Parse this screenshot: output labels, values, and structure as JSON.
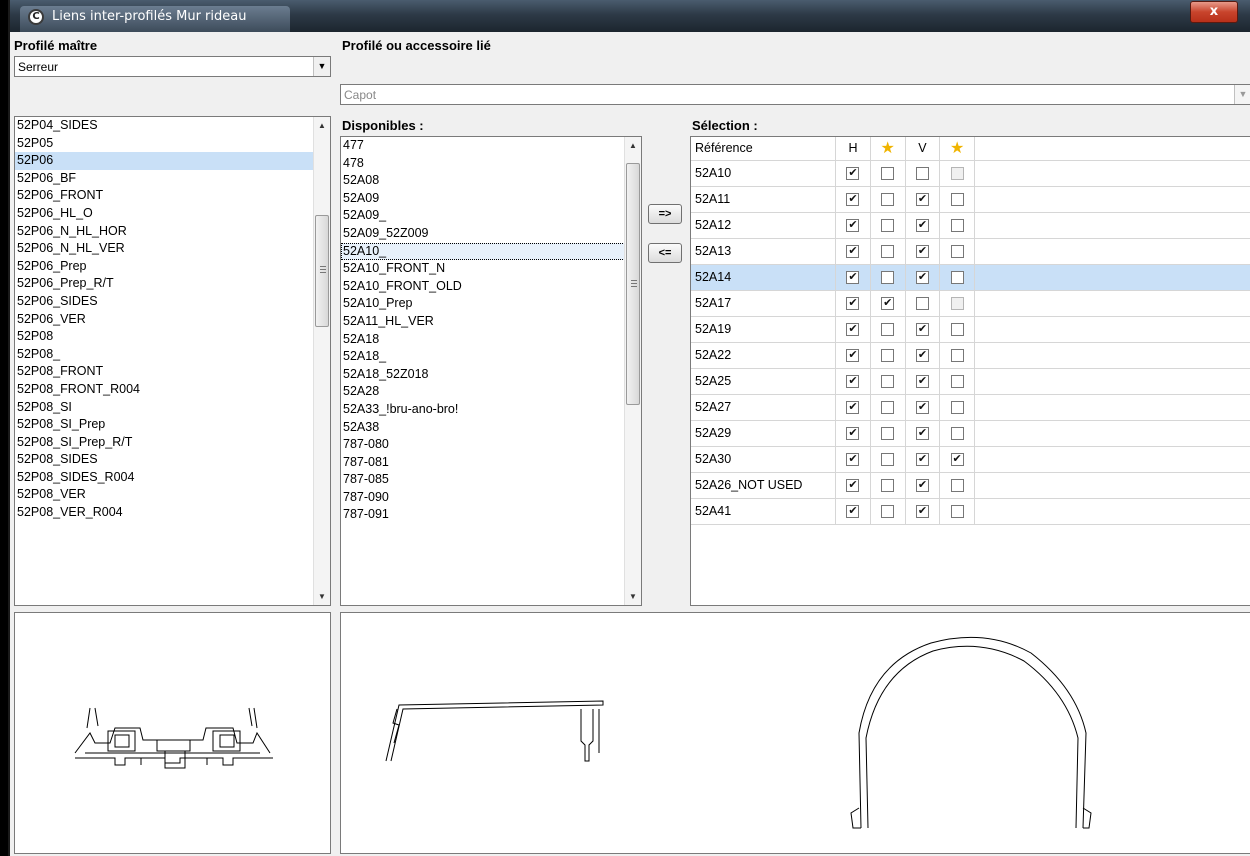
{
  "window": {
    "title": "Liens inter-profilés Mur rideau",
    "close_label": "x",
    "app_icon_glyph": "C"
  },
  "master": {
    "label": "Profilé maître",
    "combo_value": "Serreur",
    "items": [
      "52P04_SIDES",
      "52P05",
      "52P06",
      "52P06_BF",
      "52P06_FRONT",
      "52P06_HL_O",
      "52P06_N_HL_HOR",
      "52P06_N_HL_VER",
      "52P06_Prep",
      "52P06_Prep_R/T",
      "52P06_SIDES",
      "52P06_VER",
      "52P08",
      "52P08_",
      "52P08_FRONT",
      "52P08_FRONT_R004",
      "52P08_SI",
      "52P08_SI_Prep",
      "52P08_SI_Prep_R/T",
      "52P08_SIDES",
      "52P08_SIDES_R004",
      "52P08_VER",
      "52P08_VER_R004"
    ],
    "selected_index": 2
  },
  "linked": {
    "label": "Profilé ou accessoire lié",
    "combo_value": "Capot"
  },
  "available": {
    "label": "Disponibles :",
    "items": [
      "477",
      "478",
      "52A08",
      "52A09",
      "52A09_",
      "52A09_52Z009",
      "52A10_",
      "52A10_FRONT_N",
      "52A10_FRONT_OLD",
      "52A10_Prep",
      "52A11_HL_VER",
      "52A18",
      "52A18_",
      "52A18_52Z018",
      "52A28",
      "52A33_!bru-ano-bro!",
      "52A38",
      "787-080",
      "787-081",
      "787-085",
      "787-090",
      "787-091"
    ],
    "focused_index": 6
  },
  "buttons": {
    "add": "=>",
    "remove": "<="
  },
  "selection": {
    "label": "Sélection :",
    "headers": {
      "ref": "Référence",
      "h": "H",
      "v": "V"
    },
    "star_icon": "star-icon",
    "selected_row": 4,
    "rows": [
      {
        "ref": "52A10",
        "h": true,
        "hs": false,
        "v": false,
        "vs": false,
        "vs_grey": true
      },
      {
        "ref": "52A11",
        "h": true,
        "hs": false,
        "v": true,
        "vs": false,
        "vs_grey": false
      },
      {
        "ref": "52A12",
        "h": true,
        "hs": false,
        "v": true,
        "vs": false,
        "vs_grey": false
      },
      {
        "ref": "52A13",
        "h": true,
        "hs": false,
        "v": true,
        "vs": false,
        "vs_grey": false
      },
      {
        "ref": "52A14",
        "h": true,
        "hs": false,
        "v": true,
        "vs": false,
        "vs_grey": false
      },
      {
        "ref": "52A17",
        "h": true,
        "hs": true,
        "v": false,
        "vs": false,
        "vs_grey": true
      },
      {
        "ref": "52A19",
        "h": true,
        "hs": false,
        "v": true,
        "vs": false,
        "vs_grey": false
      },
      {
        "ref": "52A22",
        "h": true,
        "hs": false,
        "v": true,
        "vs": false,
        "vs_grey": false
      },
      {
        "ref": "52A25",
        "h": true,
        "hs": false,
        "v": true,
        "vs": false,
        "vs_grey": false
      },
      {
        "ref": "52A27",
        "h": true,
        "hs": false,
        "v": true,
        "vs": false,
        "vs_grey": false
      },
      {
        "ref": "52A29",
        "h": true,
        "hs": false,
        "v": true,
        "vs": false,
        "vs_grey": false
      },
      {
        "ref": "52A30",
        "h": true,
        "hs": false,
        "v": true,
        "vs": true,
        "vs_grey": false
      },
      {
        "ref": "52A26_NOT USED",
        "h": true,
        "hs": false,
        "v": true,
        "vs": false,
        "vs_grey": false
      },
      {
        "ref": "52A41",
        "h": true,
        "hs": false,
        "v": true,
        "vs": false,
        "vs_grey": false
      }
    ]
  },
  "colors": {
    "selection": "#c9e0f7",
    "star": "#f0b400",
    "close": "#c8442c"
  }
}
